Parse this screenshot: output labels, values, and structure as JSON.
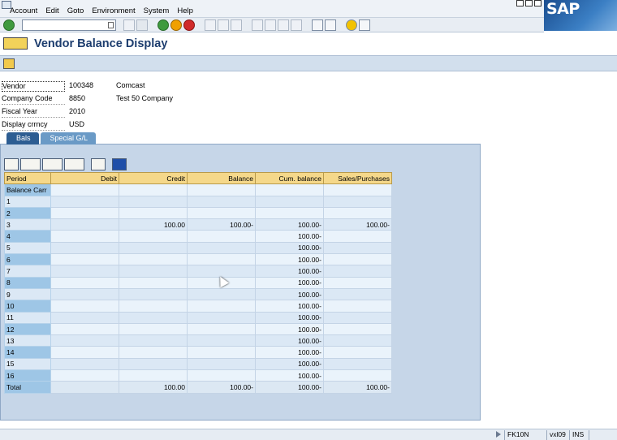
{
  "menu": {
    "items": [
      "Account",
      "Edit",
      "Goto",
      "Environment",
      "System",
      "Help"
    ]
  },
  "logo": {
    "text": "SAP"
  },
  "command_field": {
    "value": ""
  },
  "title": "Vendor Balance Display",
  "fields": [
    {
      "label": "Vendor",
      "value": "100348",
      "desc": "Comcast"
    },
    {
      "label": "Company Code",
      "value": "8850",
      "desc": "Test 50 Company"
    },
    {
      "label": "Fiscal Year",
      "value": "2010",
      "desc": ""
    },
    {
      "label": "Display crrncy",
      "value": "USD",
      "desc": ""
    }
  ],
  "tabs": [
    {
      "label": "Bals",
      "active": true
    },
    {
      "label": "Special G/L",
      "active": false
    }
  ],
  "grid": {
    "columns": [
      "Period",
      "Debit",
      "Credit",
      "Balance",
      "Cum. balance",
      "Sales/Purchases"
    ],
    "rows": [
      [
        "Balance Carr",
        "",
        "",
        "",
        "",
        ""
      ],
      [
        "1",
        "",
        "",
        "",
        "",
        ""
      ],
      [
        "2",
        "",
        "",
        "",
        "",
        ""
      ],
      [
        "3",
        "",
        "100.00",
        "100.00-",
        "100.00-",
        "100.00-"
      ],
      [
        "4",
        "",
        "",
        "",
        "100.00-",
        ""
      ],
      [
        "5",
        "",
        "",
        "",
        "100.00-",
        ""
      ],
      [
        "6",
        "",
        "",
        "",
        "100.00-",
        ""
      ],
      [
        "7",
        "",
        "",
        "",
        "100.00-",
        ""
      ],
      [
        "8",
        "",
        "",
        "",
        "100.00-",
        ""
      ],
      [
        "9",
        "",
        "",
        "",
        "100.00-",
        ""
      ],
      [
        "10",
        "",
        "",
        "",
        "100.00-",
        ""
      ],
      [
        "11",
        "",
        "",
        "",
        "100.00-",
        ""
      ],
      [
        "12",
        "",
        "",
        "",
        "100.00-",
        ""
      ],
      [
        "13",
        "",
        "",
        "",
        "100.00-",
        ""
      ],
      [
        "14",
        "",
        "",
        "",
        "100.00-",
        ""
      ],
      [
        "15",
        "",
        "",
        "",
        "100.00-",
        ""
      ],
      [
        "16",
        "",
        "",
        "",
        "100.00-",
        ""
      ]
    ],
    "total": [
      "Total",
      "",
      "100.00",
      "100.00-",
      "100.00-",
      "100.00-"
    ]
  },
  "status": {
    "transaction": "FK10N",
    "server": "vxl09",
    "mode": "INS"
  }
}
